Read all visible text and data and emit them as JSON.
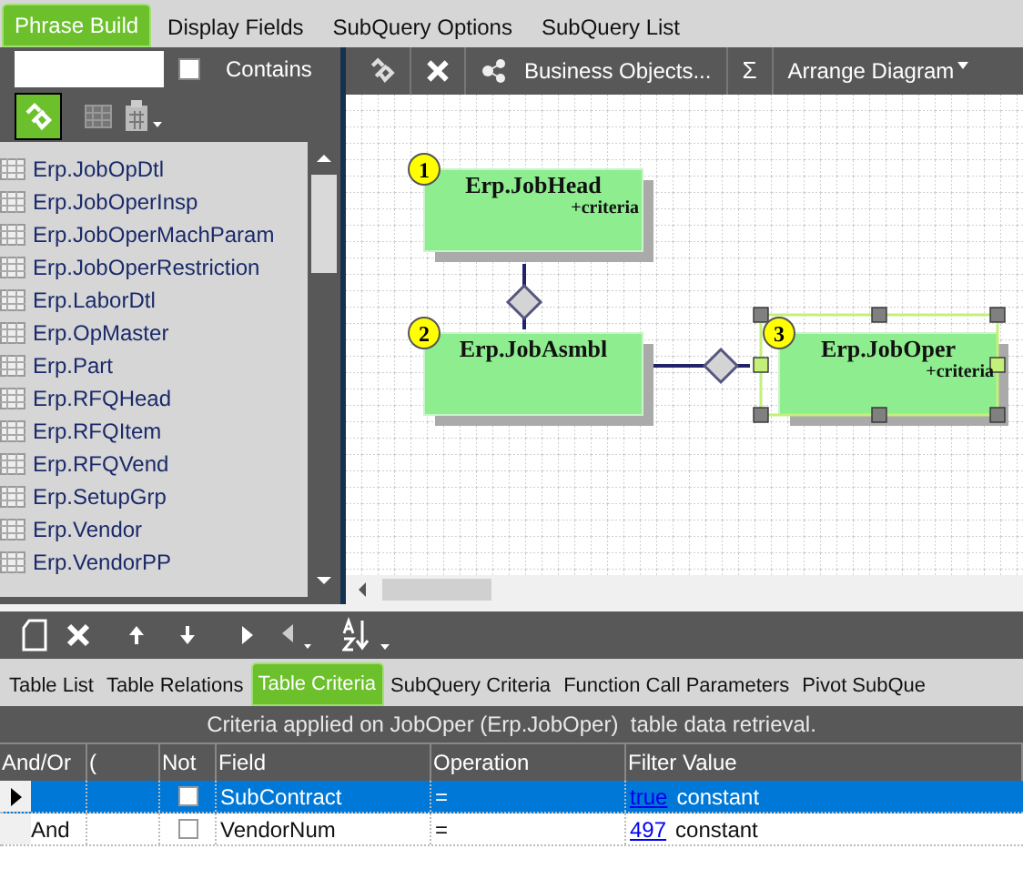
{
  "tabs": [
    {
      "label": "Phrase Build",
      "selected": true
    },
    {
      "label": "Display Fields",
      "selected": false
    },
    {
      "label": "SubQuery Options",
      "selected": false
    },
    {
      "label": "SubQuery List",
      "selected": false
    }
  ],
  "contains_checkbox": {
    "label": "Contains",
    "checked": false
  },
  "table_list": [
    "Erp.JobOpDtl",
    "Erp.JobOperInsp",
    "Erp.JobOperMachParam",
    "Erp.JobOperRestriction",
    "Erp.LaborDtl",
    "Erp.OpMaster",
    "Erp.Part",
    "Erp.RFQHead",
    "Erp.RFQItem",
    "Erp.RFQVend",
    "Erp.SetupGrp",
    "Erp.Vendor",
    "Erp.VendorPP"
  ],
  "diagram_toolbar": {
    "business_objects": "Business Objects...",
    "sum": "Σ",
    "arrange": "Arrange Diagram"
  },
  "diagram": {
    "nodes": [
      {
        "number": "1",
        "name": "Erp.JobHead",
        "note": "+criteria",
        "selected": false
      },
      {
        "number": "2",
        "name": "Erp.JobAsmbl",
        "selected": false
      },
      {
        "number": "3",
        "name": "Erp.JobOper",
        "note": "+criteria",
        "selected": true
      }
    ]
  },
  "bottom_tabs": [
    {
      "label": "Table List",
      "selected": false
    },
    {
      "label": "Table Relations",
      "selected": false
    },
    {
      "label": "Table Criteria",
      "selected": true
    },
    {
      "label": "SubQuery Criteria",
      "selected": false
    },
    {
      "label": "Function Call Parameters",
      "selected": false
    },
    {
      "label": "Pivot SubQue",
      "selected": false
    }
  ],
  "criteria": {
    "caption": "Criteria applied on JobOper (Erp.JobOper)  table data retrieval.",
    "columns": [
      "And/Or",
      "(",
      "Not",
      "Field",
      "Operation",
      "Filter Value"
    ],
    "rows": [
      {
        "and_or": "",
        "not": false,
        "field": "SubContract",
        "operation": "=",
        "value": "true",
        "value_type": "constant",
        "selected": true
      },
      {
        "and_or": "And",
        "not": false,
        "field": "VendorNum",
        "operation": "=",
        "value": "497",
        "value_type": "constant",
        "selected": false
      }
    ]
  }
}
